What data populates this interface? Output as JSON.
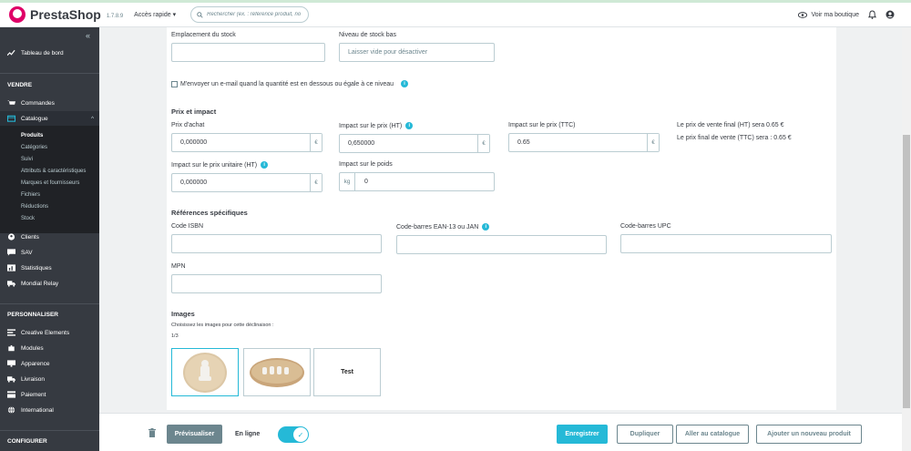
{
  "topbar": {
    "logo": "PrestaShop",
    "version": "1.7.8.9",
    "quick_access": "Accès rapide ▾",
    "search_placeholder": "Rechercher (ex. : référence produit, no",
    "view_shop": "Voir ma boutique"
  },
  "sidebar": {
    "dashboard": "Tableau de bord",
    "section_sell": "VENDRE",
    "orders": "Commandes",
    "catalog": "Catalogue",
    "catalog_sub": [
      "Produits",
      "Catégories",
      "Suivi",
      "Attributs & caractéristiques",
      "Marques et fournisseurs",
      "Fichiers",
      "Réductions",
      "Stock"
    ],
    "clients": "Clients",
    "sav": "SAV",
    "stats": "Statistiques",
    "mondial": "Mondial Relay",
    "section_customize": "PERSONNALISER",
    "creative": "Creative Elements",
    "modules": "Modules",
    "appearance": "Apparence",
    "shipping": "Livraison",
    "payment": "Paiement",
    "international": "International",
    "section_configure": "CONFIGURER"
  },
  "form": {
    "stock_location_label": "Emplacement du stock",
    "low_stock_label": "Niveau de stock bas",
    "low_stock_placeholder": "Laisser vide pour désactiver",
    "email_checkbox": "M'envoyer un e-mail quand la quantité est en dessous ou égale à ce niveau",
    "price_section": "Prix et impact",
    "purchase_price_label": "Prix d'achat",
    "purchase_price_value": "0,000000",
    "impact_ht_label": "Impact sur le prix (HT)",
    "impact_ht_value": "0,650000",
    "impact_ttc_label": "Impact sur le prix (TTC)",
    "impact_ttc_value": "0.65",
    "final_ht": "Le prix de vente final (HT) sera 0.65 €",
    "final_ttc": "Le prix final de vente (TTC) sera : 0.65 €",
    "unit_impact_label": "Impact sur le prix unitaire (HT)",
    "unit_impact_value": "0,000000",
    "weight_impact_label": "Impact sur le poids",
    "weight_unit": "kg",
    "weight_value": "0",
    "currency": "€",
    "refs_section": "Références spécifiques",
    "isbn_label": "Code ISBN",
    "ean_label": "Code-barres EAN-13 ou JAN",
    "upc_label": "Code-barres UPC",
    "mpn_label": "MPN",
    "images_section": "Images",
    "images_hint": "Choisissez les images pour cette déclinaison :",
    "images_count": "1/3",
    "test_label": "Test"
  },
  "footer": {
    "preview": "Prévisualiser",
    "online": "En ligne",
    "save": "Enregistrer",
    "duplicate": "Dupliquer",
    "go_catalog": "Aller au catalogue",
    "add_product": "Ajouter un nouveau produit"
  },
  "colors": {
    "accent": "#25b9d7",
    "sidebar": "#363a41",
    "brand": "#df0067"
  }
}
